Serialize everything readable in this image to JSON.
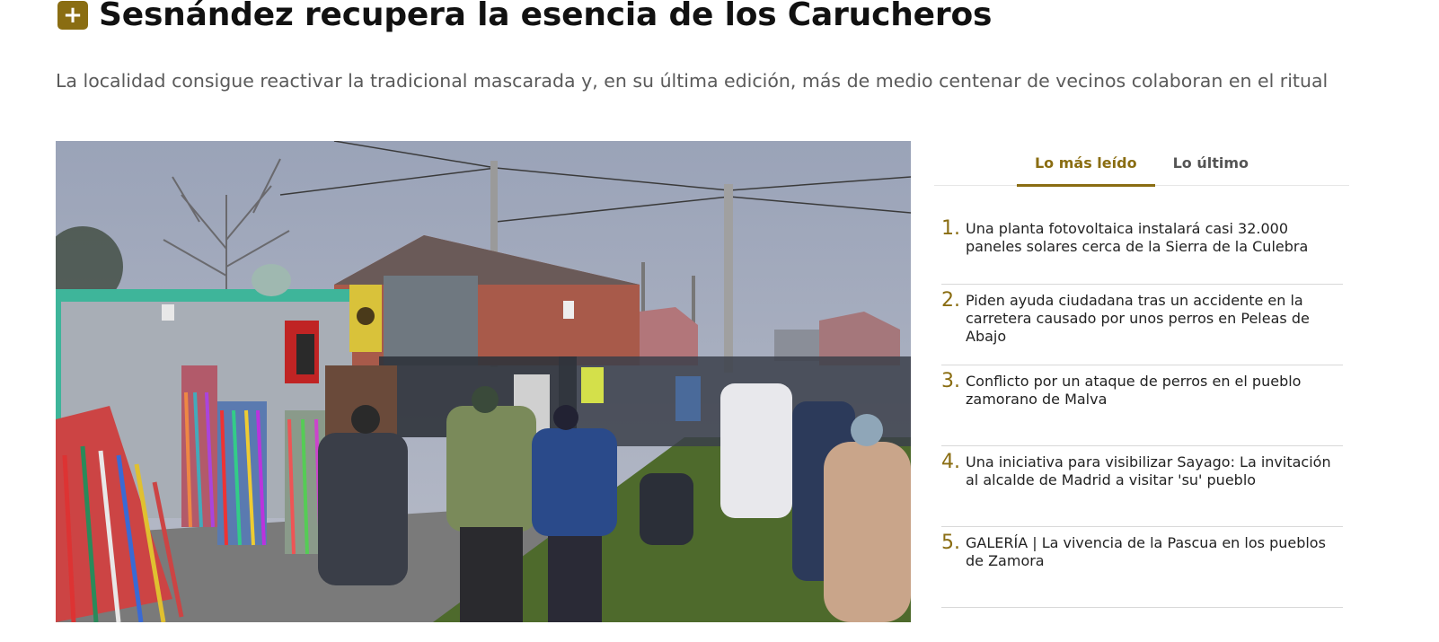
{
  "article": {
    "badge_symbol": "+",
    "title": "Sesnández recupera la esencia de los Carucheros",
    "subtitle": "La localidad consigue reactivar la tradicional mascarada y, en su última edición, más de medio centenar de vecinos colaboran en el ritual"
  },
  "sidebar": {
    "tabs": [
      {
        "label": "Lo más leído",
        "active": true
      },
      {
        "label": "Lo último",
        "active": false
      }
    ],
    "items": [
      {
        "number": "1.",
        "text": "Una planta fotovoltaica instalará casi 32.000 paneles solares cerca de la Sierra de la Culebra"
      },
      {
        "number": "2.",
        "text": "Piden ayuda ciudadana tras un accidente en la carretera causado por unos perros en Peleas de Abajo"
      },
      {
        "number": "3.",
        "text": "Conflicto por un ataque de perros en el pueblo zamorano de Malva"
      },
      {
        "number": "4.",
        "text": "Una iniciativa para visibilizar Sayago: La invitación al alcalde de Madrid a visitar 'su' pueblo"
      },
      {
        "number": "5.",
        "text": "GALERÍA | La vivencia de la Pascua en los pueblos de Zamora"
      }
    ]
  },
  "colors": {
    "accent": "#8a6d12",
    "title": "#111111",
    "subtitle": "#5a5a5a"
  }
}
